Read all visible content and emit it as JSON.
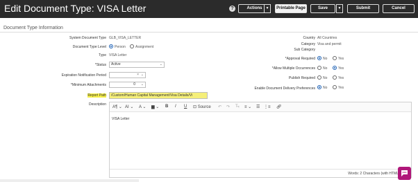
{
  "header": {
    "title": "Edit Document Type: VISA Letter",
    "help_icon": "question-icon",
    "actions_label": "Actions",
    "printable_page_label": "Printable Page",
    "save_label": "Save",
    "submit_label": "Submit",
    "cancel_label": "Cancel"
  },
  "section": {
    "title": "Document Type Information"
  },
  "left": {
    "system_doc_type_label": "System Document Type",
    "system_doc_type_value": "GLB_VISA_LETTER",
    "doc_type_level_label": "Document Type Level",
    "level_person": "Person",
    "level_assignment": "Assignment",
    "type_label": "Type",
    "type_value": "VISA Letter",
    "status_label": "Status",
    "status_value": "Active",
    "exp_notif_label": "Expiration Notification Period",
    "exp_notif_value": "",
    "min_attach_label": "Minimum Attachments",
    "min_attach_value": "0",
    "report_path_label": "Report Path",
    "report_path_value": "/Custom/Human Capital Management/Visa Details/Vi",
    "description_label": "Description"
  },
  "right": {
    "country_label": "Country",
    "country_value": "All Countries",
    "category_label": "Category",
    "category_value": "Visa and permit",
    "subcategory_label": "Sub Category",
    "approval_label": "Approval Required",
    "multiple_label": "Allow Multiple Occurrences",
    "publish_label": "Publish Required",
    "delivery_label": "Enable Document Delivery Preferences",
    "no": "No",
    "yes": "Yes"
  },
  "editor": {
    "styles_label": "A",
    "size_label": "A",
    "source_label": "Source",
    "body_text": "VISA Letter",
    "word_count": "Words: 2 Characters (with HTML"
  },
  "colors": {
    "accent": "#b0177a",
    "highlight": "#f7f04a",
    "header": "#2b2b2b"
  }
}
